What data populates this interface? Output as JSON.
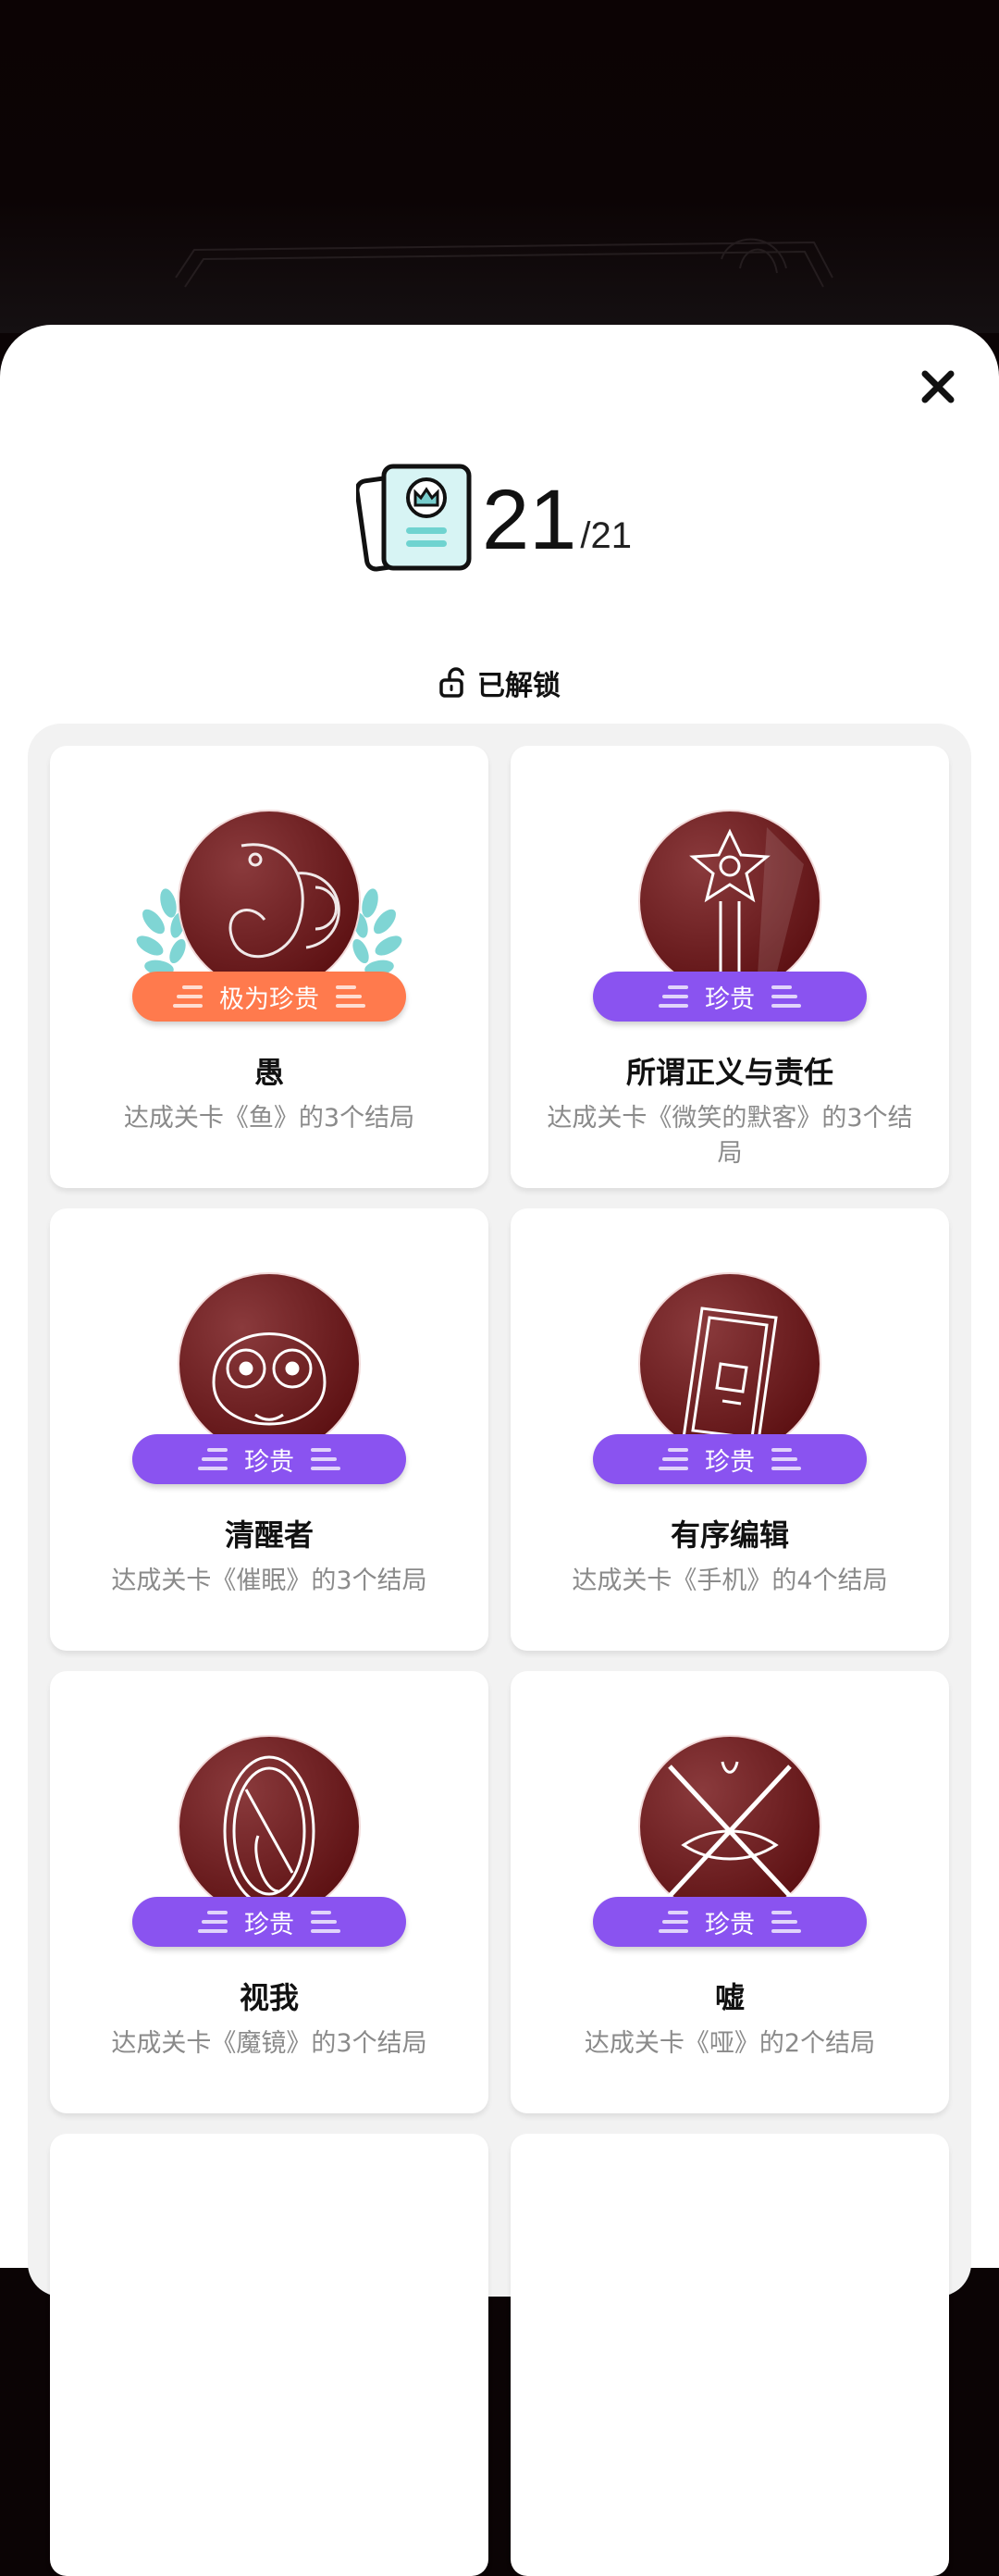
{
  "header": {
    "unlocked_count": "21",
    "total": "/21",
    "section_label": "已解锁"
  },
  "icons": {
    "close": "close-icon",
    "summary": "achievement-book-icon",
    "section": "unlock-icon"
  },
  "colors": {
    "rare": "#8a53f0",
    "very_rare": "#ff7a4d",
    "medal": "#6b1418"
  },
  "achievements": [
    {
      "name": "愚",
      "rarity": "极为珍贵",
      "description": "达成关卡《鱼》的3个结局",
      "icon": "fish-medal-icon"
    },
    {
      "name": "所谓正义与责任",
      "rarity": "珍贵",
      "description": "达成关卡《微笑的默客》的3个结局",
      "icon": "star-sword-medal-icon"
    },
    {
      "name": "清醒者",
      "rarity": "珍贵",
      "description": "达成关卡《催眠》的3个结局",
      "icon": "wide-eyes-medal-icon"
    },
    {
      "name": "有序编辑",
      "rarity": "珍贵",
      "description": "达成关卡《手机》的4个结局",
      "icon": "phone-medal-icon"
    },
    {
      "name": "视我",
      "rarity": "珍贵",
      "description": "达成关卡《魔镜》的3个结局",
      "icon": "mirror-medal-icon"
    },
    {
      "name": "嘘",
      "rarity": "珍贵",
      "description": "达成关卡《哑》的2个结局",
      "icon": "crossed-mouth-medal-icon"
    }
  ]
}
